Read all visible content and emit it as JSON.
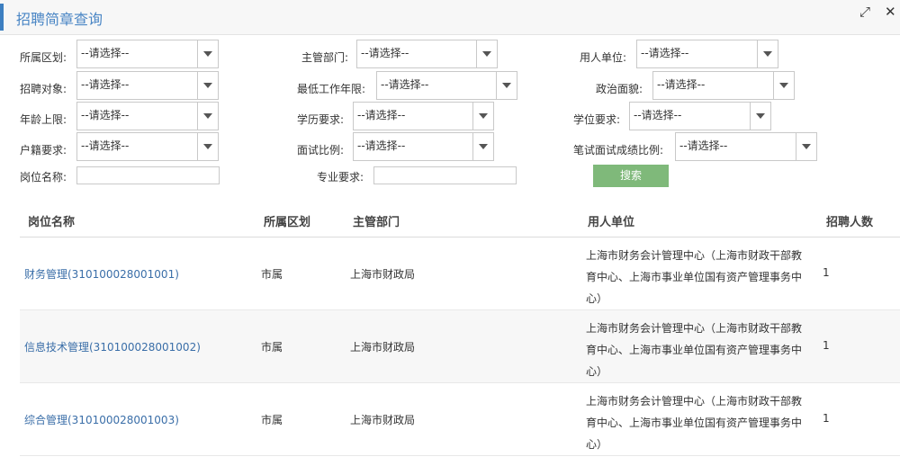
{
  "window": {
    "title": "招聘简章查询",
    "expand_icon": "expand-icon",
    "close_icon": "close-icon"
  },
  "filters": {
    "district": {
      "label": "所属区划:",
      "value": "--请选择--"
    },
    "dept": {
      "label": "主管部门:",
      "value": "--请选择--"
    },
    "employer": {
      "label": "用人单位:",
      "value": "--请选择--"
    },
    "target": {
      "label": "招聘对象:",
      "value": "--请选择--"
    },
    "min_years": {
      "label": "最低工作年限:",
      "value": "--请选择--"
    },
    "political": {
      "label": "政治面貌:",
      "value": "--请选择--"
    },
    "age": {
      "label": "年龄上限:",
      "value": "--请选择--"
    },
    "education": {
      "label": "学历要求:",
      "value": "--请选择--"
    },
    "degree": {
      "label": "学位要求:",
      "value": "--请选择--"
    },
    "hukou": {
      "label": "户籍要求:",
      "value": "--请选择--"
    },
    "interview_ratio": {
      "label": "面试比例:",
      "value": "--请选择--"
    },
    "score_ratio": {
      "label": "笔试面试成绩比例:",
      "value": "--请选择--"
    },
    "position_name": {
      "label": "岗位名称:",
      "value": ""
    },
    "major": {
      "label": "专业要求:",
      "value": ""
    }
  },
  "search_button": "搜索",
  "table": {
    "headers": [
      "岗位名称",
      "所属区划",
      "主管部门",
      "用人单位",
      "招聘人数"
    ],
    "rows": [
      {
        "name": "财务管理(310100028001001)",
        "district": "市属",
        "dept": "上海市财政局",
        "unit": "上海市财务会计管理中心（上海市财政干部教育中心、上海市事业单位国有资产管理事务中心）",
        "count": "1"
      },
      {
        "name": "信息技术管理(310100028001002)",
        "district": "市属",
        "dept": "上海市财政局",
        "unit": "上海市财务会计管理中心（上海市财政干部教育中心、上海市事业单位国有资产管理事务中心）",
        "count": "1"
      },
      {
        "name": "综合管理(310100028001003)",
        "district": "市属",
        "dept": "上海市财政局",
        "unit": "上海市财务会计管理中心（上海市财政干部教育中心、上海市事业单位国有资产管理事务中心）",
        "count": "1"
      }
    ]
  },
  "colors": {
    "accent": "#3d7fc1",
    "title": "#4a86c5",
    "link": "#3a6ea8",
    "search_button": "#7fb97a"
  }
}
